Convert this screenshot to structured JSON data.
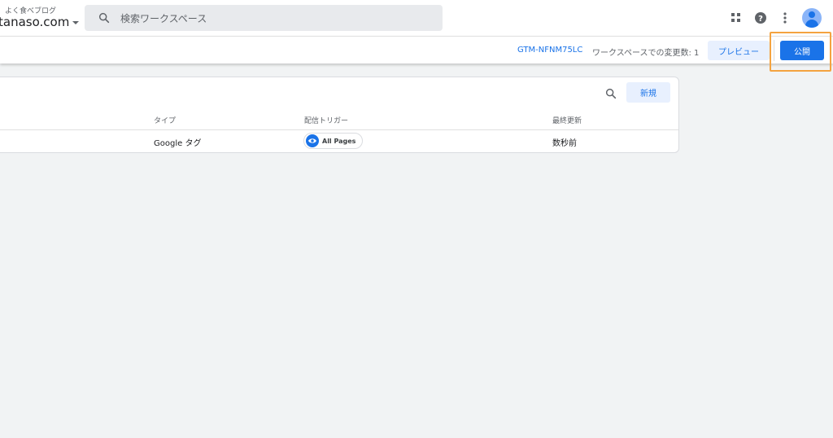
{
  "account": {
    "subtitle": "よく食べブログ",
    "name": "tanaso.com"
  },
  "search": {
    "placeholder": "検索ワークスペース"
  },
  "icons": {
    "apps": "apps-grid-icon",
    "help": "help-icon",
    "more": "more-vert-icon",
    "avatar": "account-avatar"
  },
  "workspace_bar": {
    "container_id": "GTM-NFNM75LC",
    "changes_text": "ワークスペースでの変更数: 1",
    "preview_label": "プレビュー",
    "publish_label": "公開"
  },
  "tags_table": {
    "new_label": "新規",
    "columns": {
      "type": "タイプ",
      "trigger": "配信トリガー",
      "updated": "最終更新"
    },
    "rows": [
      {
        "type": "Google タグ",
        "trigger": "All Pages",
        "updated": "数秒前"
      }
    ]
  },
  "colors": {
    "accent": "#1a73e8",
    "highlight": "#f4a340",
    "background": "#f1f3f4"
  }
}
